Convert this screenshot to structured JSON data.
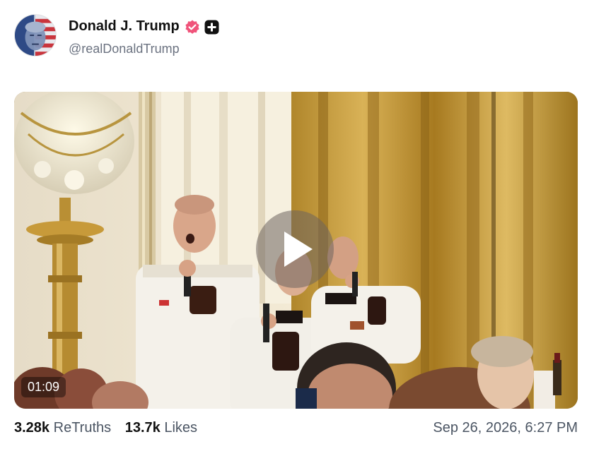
{
  "post": {
    "author": {
      "display_name": "Donald J. Trump",
      "handle": "@realDonaldTrump",
      "verified_icon": "verified-badge-icon",
      "plus_icon": "plus-badge-icon"
    },
    "video": {
      "duration": "01:09",
      "play_icon": "play-icon"
    },
    "stats": {
      "retruths_count": "3.28k",
      "retruths_label": "ReTruths",
      "likes_count": "13.7k",
      "likes_label": "Likes"
    },
    "timestamp": "Sep 26, 2026, 6:27 PM"
  },
  "colors": {
    "verified_badge": "#f0537a",
    "plus_badge": "#111111",
    "muted_text": "#4b5563"
  }
}
